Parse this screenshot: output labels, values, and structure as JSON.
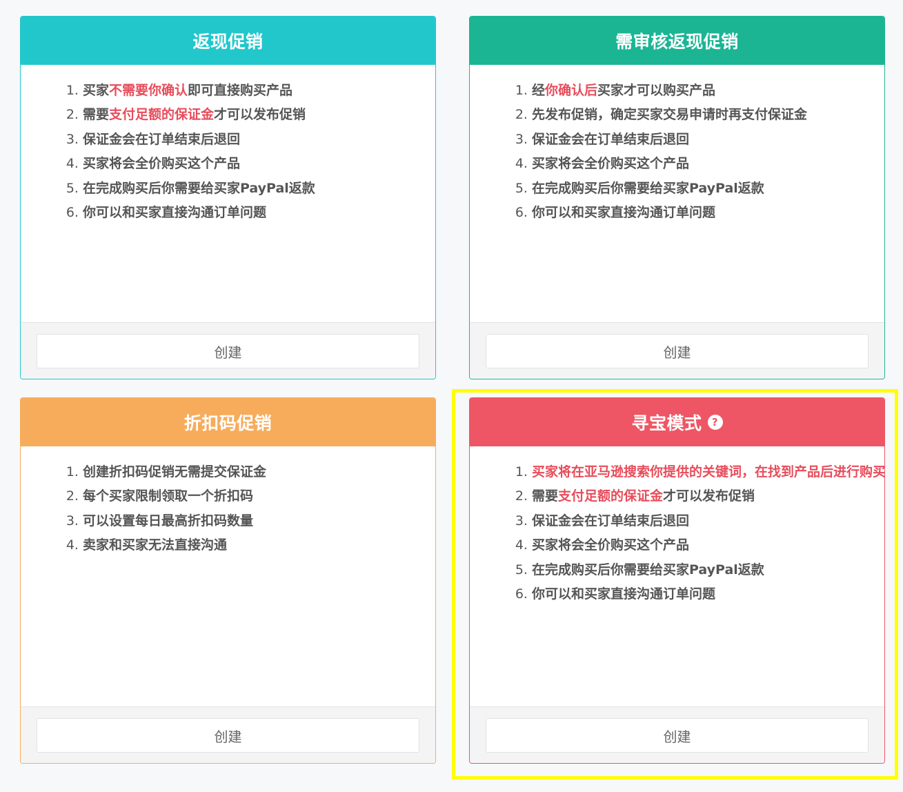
{
  "colors": {
    "cashback": "#22c7cc",
    "review_cashback": "#1bb594",
    "discount_code": "#f7ac5b",
    "treasure_hunt": "#ee5665",
    "highlight_text": "#e84c5b",
    "highlight_frame": "#ffff00"
  },
  "cards": [
    {
      "title": "返现促销",
      "items": [
        [
          "1",
          "买家",
          "不需要你确认",
          "即可直接购买产品"
        ],
        [
          "2",
          "需要",
          "支付足额的保证金",
          "才可以发布促销"
        ],
        [
          "3",
          "保证金会在订单结束后退回",
          "",
          ""
        ],
        [
          "4",
          "买家将会全价购买这个产品",
          "",
          ""
        ],
        [
          "5",
          "在完成购买后你需要给买家PayPal返款",
          "",
          ""
        ],
        [
          "6",
          "你可以和买家直接沟通订单问题",
          "",
          ""
        ]
      ],
      "button_label": "创建"
    },
    {
      "title": "需审核返现促销",
      "items": [
        [
          "1",
          "经",
          "你确认后",
          "买家才可以购买产品"
        ],
        [
          "2",
          "先发布促销，确定买家交易申请时再支付保证金",
          "",
          ""
        ],
        [
          "3",
          "保证金会在订单结束后退回",
          "",
          ""
        ],
        [
          "4",
          "买家将会全价购买这个产品",
          "",
          ""
        ],
        [
          "5",
          "在完成购买后你需要给买家PayPal返款",
          "",
          ""
        ],
        [
          "6",
          "你可以和买家直接沟通订单问题",
          "",
          ""
        ]
      ],
      "button_label": "创建"
    },
    {
      "title": "折扣码促销",
      "items": [
        [
          "1",
          "创建折扣码促销无需提交保证金",
          "",
          ""
        ],
        [
          "2",
          "每个买家限制领取一个折扣码",
          "",
          ""
        ],
        [
          "3",
          "可以设置每日最高折扣码数量",
          "",
          ""
        ],
        [
          "4",
          "卖家和买家无法直接沟通",
          "",
          ""
        ]
      ],
      "button_label": "创建"
    },
    {
      "title": "寻宝模式",
      "help_icon": "question-circle-icon",
      "items": [
        [
          "1",
          "",
          "买家将在亚马逊搜索你提供的关键词，在找到产品后进行购买",
          ""
        ],
        [
          "2",
          "需要",
          "支付足额的保证金",
          "才可以发布促销"
        ],
        [
          "3",
          "保证金会在订单结束后退回",
          "",
          ""
        ],
        [
          "4",
          "买家将会全价购买这个产品",
          "",
          ""
        ],
        [
          "5",
          "在完成购买后你需要给买家PayPal返款",
          "",
          ""
        ],
        [
          "6",
          "你可以和买家直接沟通订单问题",
          "",
          ""
        ]
      ],
      "button_label": "创建"
    }
  ]
}
